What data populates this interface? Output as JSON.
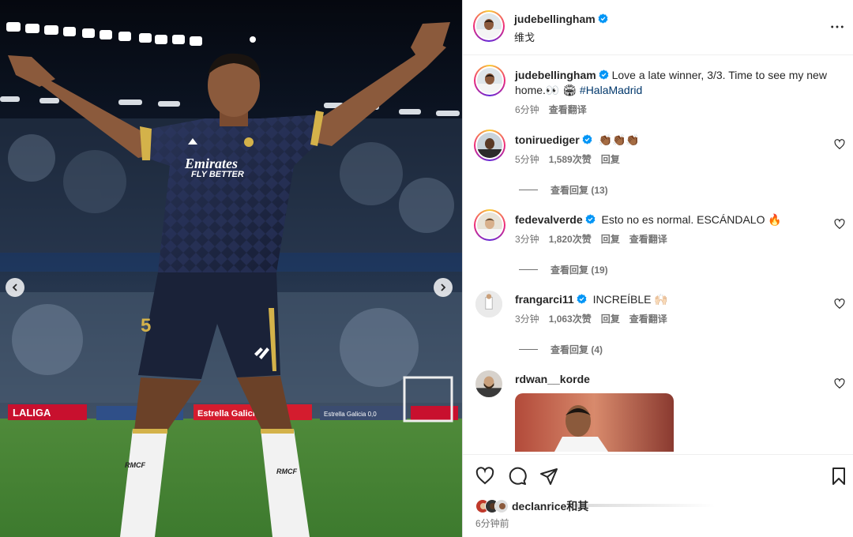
{
  "media": {
    "sponsor_line1": "Emirates",
    "sponsor_line2": "FLY BETTER",
    "shirt_number": "5",
    "boards": [
      "LALIGA",
      "Estrella Galicia",
      "Estrella Galicia 0,0"
    ],
    "sock_brand": "RMCF"
  },
  "post_header": {
    "username": "judebellingham",
    "subtitle": "维戈"
  },
  "caption": {
    "username": "judebellingham",
    "text": "Love a late winner, 3/3. Time to see my new home.👀 🏟",
    "hashtag": "#HalaMadrid",
    "time": "6分钟",
    "translate": "查看翻译"
  },
  "comments": [
    {
      "username": "toniruediger",
      "text": "👏🏾👏🏾👏🏾",
      "time": "5分钟",
      "likes": "1,589次赞",
      "reply": "回复",
      "view_replies": "查看回复 (13)"
    },
    {
      "username": "fedevalverde",
      "text": "Esto no es normal. ESCÁNDALO 🔥",
      "time": "3分钟",
      "likes": "1,820次赞",
      "reply": "回复",
      "translate": "查看翻译",
      "view_replies": "查看回复 (19)"
    },
    {
      "username": "frangarci11",
      "text": "INCREÍBLE 🙌🏻",
      "time": "3分钟",
      "likes": "1,063次赞",
      "reply": "回复",
      "translate": "查看翻译",
      "view_replies": "查看回复 (4)"
    },
    {
      "username": "rdwan__korde",
      "text": ""
    }
  ],
  "footer": {
    "liked_by": "declanrice和其",
    "time_ago": "6分钟前"
  },
  "colors": {
    "verified": "#0095f6",
    "hashtag": "#00376b",
    "muted": "#737373",
    "jersey": "#1c2540"
  }
}
